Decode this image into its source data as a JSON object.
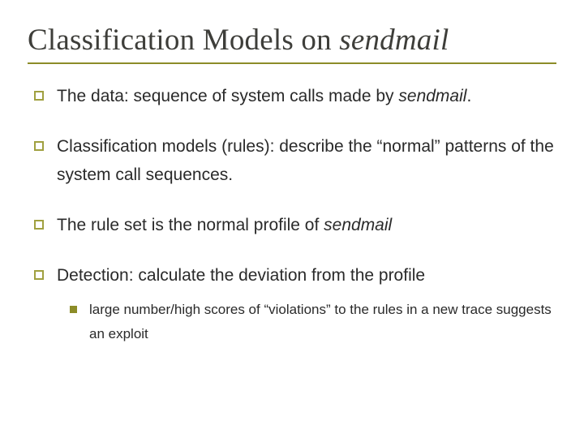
{
  "title": {
    "prefix": "Classification Models on ",
    "italic": "sendmail"
  },
  "bullets": [
    {
      "parts": [
        {
          "text": "The data: sequence of system calls made by "
        },
        {
          "text": "sendmail",
          "italic": true
        },
        {
          "text": "."
        }
      ]
    },
    {
      "parts": [
        {
          "text": "Classification models (rules): describe the “normal” patterns of the system call sequences."
        }
      ]
    },
    {
      "parts": [
        {
          "text": "The rule set is the normal profile of "
        },
        {
          "text": "sendmail",
          "italic": true
        }
      ]
    },
    {
      "parts": [
        {
          "text": "Detection: calculate the deviation from the profile"
        }
      ],
      "sub": [
        {
          "parts": [
            {
              "text": "large number/high scores of “violations” to the rules in a new trace suggests an exploit"
            }
          ]
        }
      ]
    }
  ]
}
